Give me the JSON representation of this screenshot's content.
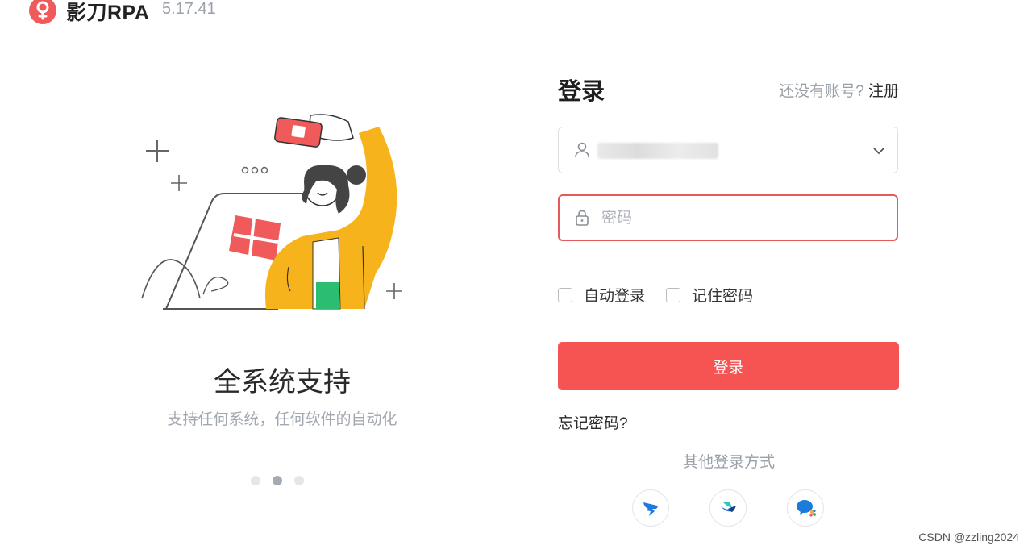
{
  "header": {
    "app_name": "影刀RPA",
    "version": "5.17.41",
    "logo_icon": "yingdao-logo-icon"
  },
  "carousel": {
    "title": "全系统支持",
    "subtitle": "支持任何系统，任何软件的自动化",
    "dot_count": 3,
    "active_index": 1
  },
  "login": {
    "title": "登录",
    "register_prompt": "还没有账号?",
    "register_link": "注册",
    "username": {
      "icon": "user-icon",
      "value_blurred": true
    },
    "password": {
      "icon": "lock-icon",
      "placeholder": "密码"
    },
    "auto_login_label": "自动登录",
    "remember_password_label": "记住密码",
    "submit_label": "登录",
    "forgot_label": "忘记密码?",
    "other_methods_label": "其他登录方式",
    "sso_methods": [
      "dingtalk-icon",
      "feishu-icon",
      "wecom-icon"
    ]
  },
  "watermark": "CSDN @zzling2024",
  "colors": {
    "primary": "#f55452",
    "error_border": "#e85a5a",
    "muted_text": "#9aa0a8",
    "illustration_yellow": "#f7b31b",
    "illustration_green": "#2bbd70"
  }
}
